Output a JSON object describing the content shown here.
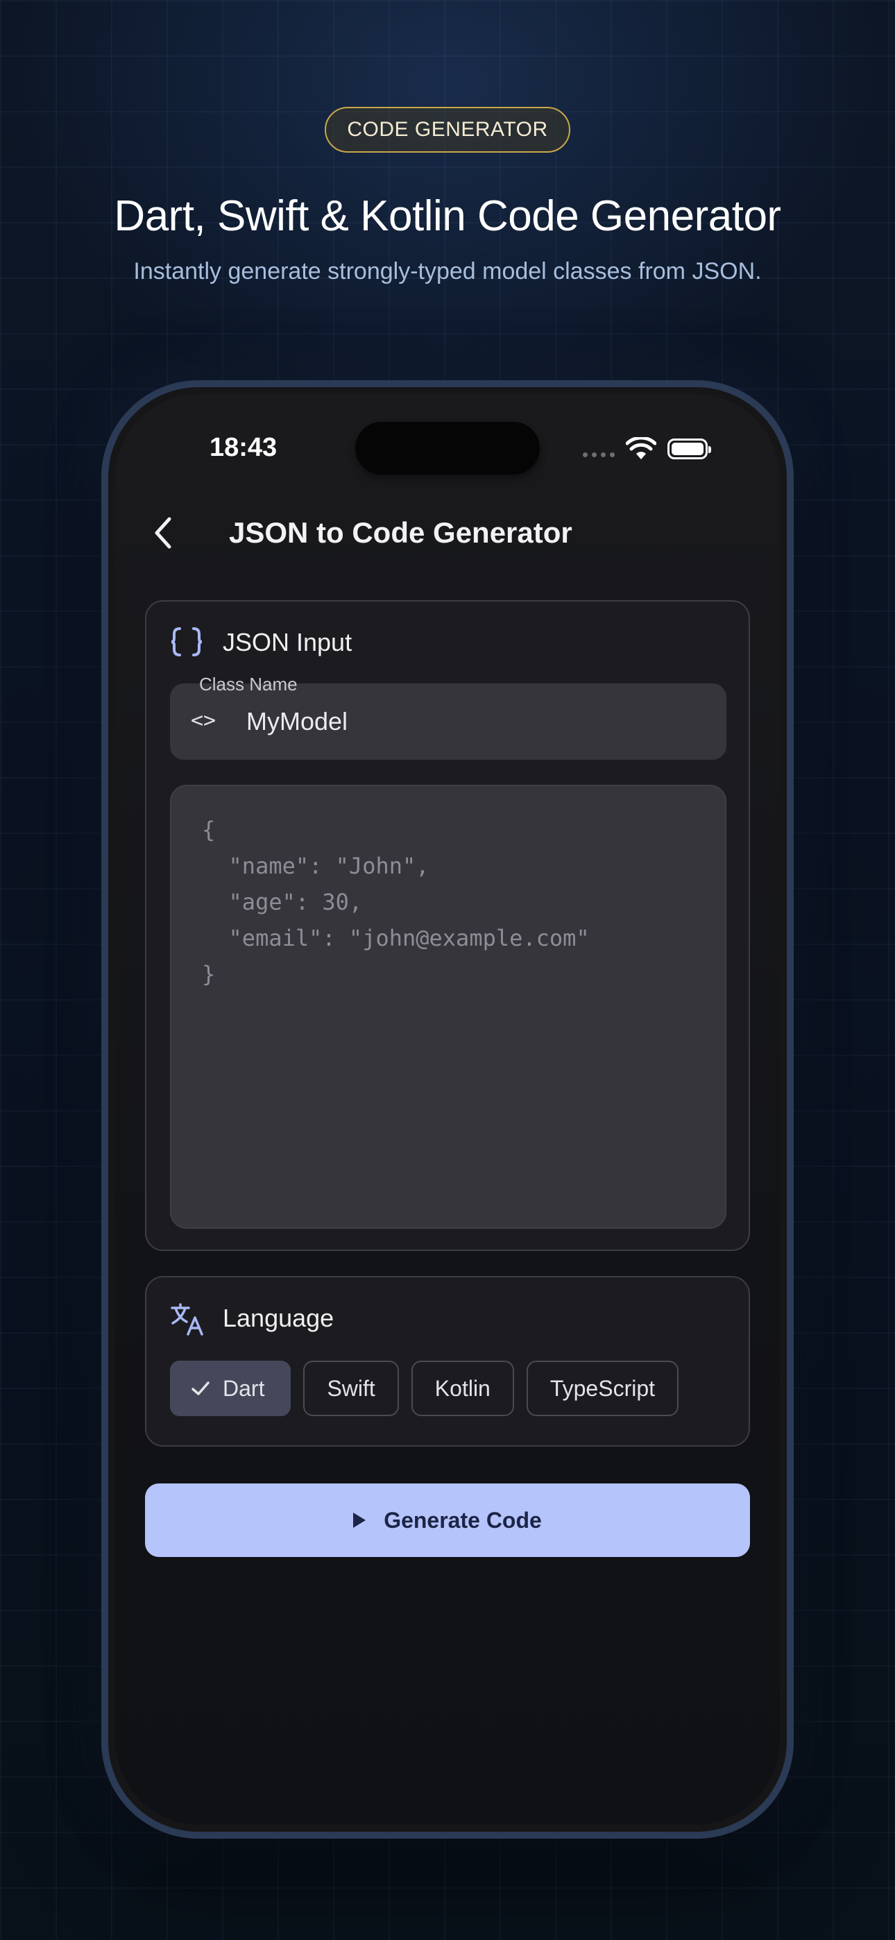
{
  "promo": {
    "badge": "CODE GENERATOR",
    "headline": "Dart, Swift & Kotlin Code Generator",
    "subheadline": "Instantly generate strongly-typed model classes from JSON."
  },
  "status_bar": {
    "time": "18:43"
  },
  "app_bar": {
    "title": "JSON to Code Generator",
    "back_icon": "chevron-left-icon"
  },
  "json_input": {
    "title": "JSON Input",
    "icon": "curly-braces-icon",
    "class_name_label": "Class Name",
    "class_name_icon": "code-brackets-icon",
    "class_name_value": "MyModel",
    "json_lines": [
      "{",
      "  \"name\": \"John\",",
      "  \"age\": 30,",
      "  \"email\": \"john@example.com\"",
      "}"
    ]
  },
  "language": {
    "title": "Language",
    "icon": "translate-icon",
    "options": [
      "Dart",
      "Swift",
      "Kotlin",
      "TypeScript"
    ],
    "selected": "Dart"
  },
  "generate_button": {
    "label": "Generate Code",
    "icon": "play-icon"
  },
  "colors": {
    "accent": "#b6c4fc",
    "badge_border": "#c9a84a",
    "icon_tint": "#a9b9f5"
  }
}
